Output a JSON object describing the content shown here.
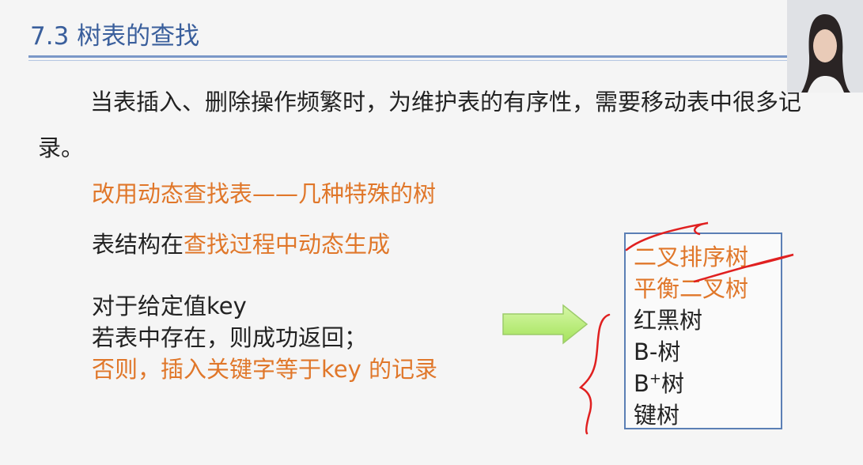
{
  "title": "7.3 树表的查找",
  "paragraph": "当表插入、删除操作频繁时，为维护表的有序性，需要移动表中很多记录。",
  "line1": "改用动态查找表——几种特殊的树",
  "line2": {
    "prefix": "表结构在",
    "highlight": "查找过程中动态生成"
  },
  "line3": "对于给定值key",
  "line4": "若表中存在，则成功返回；",
  "line5": "否则，插入关键字等于key 的记录",
  "tree_list": {
    "items": [
      {
        "prefix": "",
        "sup": "",
        "suffix": "二叉排序树",
        "color": "#e0772a"
      },
      {
        "prefix": "",
        "sup": "",
        "suffix": "平衡二叉树",
        "color": "#e0772a"
      },
      {
        "prefix": "",
        "sup": "",
        "suffix": "红黑树",
        "color": "#222222"
      },
      {
        "prefix": "B",
        "sup": "",
        "suffix": "-树",
        "color": "#222222"
      },
      {
        "prefix": "B",
        "sup": "+",
        "suffix": "树",
        "color": "#222222"
      },
      {
        "prefix": "",
        "sup": "",
        "suffix": "键树",
        "color": "#222222"
      }
    ]
  },
  "colors": {
    "title": "#3a5f9c",
    "accent_orange": "#e0772a",
    "ink_red": "#e02020",
    "arrow_fill": "#b8f06a",
    "box_border": "#5b7fb5"
  }
}
